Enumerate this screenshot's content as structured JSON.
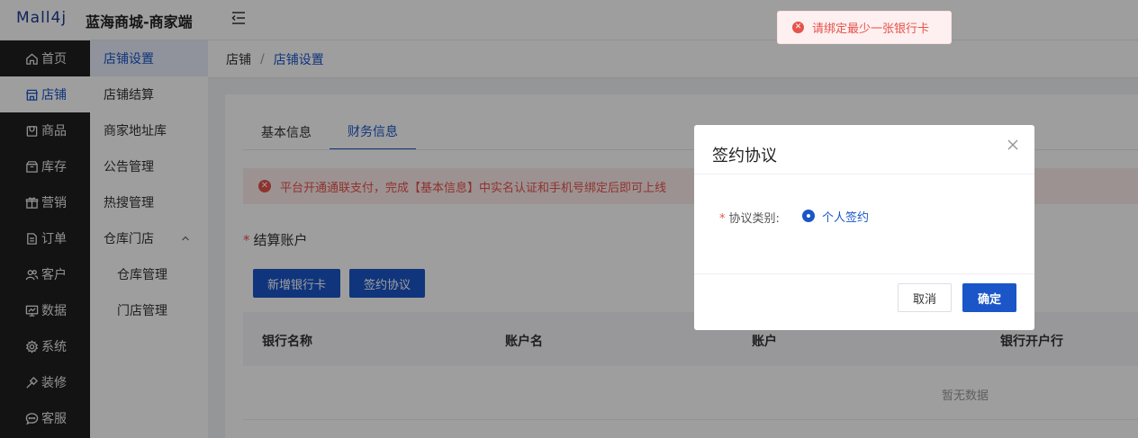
{
  "header": {
    "logo_text": "Mall4j",
    "shop_title": "蓝海商城-商家端"
  },
  "sidebar_primary": [
    {
      "label": "首页",
      "icon": "home-icon"
    },
    {
      "label": "店铺",
      "icon": "store-icon",
      "active": true
    },
    {
      "label": "商品",
      "icon": "product-icon"
    },
    {
      "label": "库存",
      "icon": "inventory-icon"
    },
    {
      "label": "营销",
      "icon": "gift-icon"
    },
    {
      "label": "订单",
      "icon": "order-icon"
    },
    {
      "label": "客户",
      "icon": "users-icon"
    },
    {
      "label": "数据",
      "icon": "chart-icon"
    },
    {
      "label": "系统",
      "icon": "gear-icon"
    },
    {
      "label": "装修",
      "icon": "decorate-icon"
    },
    {
      "label": "客服",
      "icon": "chat-icon"
    }
  ],
  "sidebar_secondary": [
    {
      "label": "店铺设置",
      "active": true
    },
    {
      "label": "店铺结算"
    },
    {
      "label": "商家地址库"
    },
    {
      "label": "公告管理"
    },
    {
      "label": "热搜管理"
    },
    {
      "label": "仓库门店",
      "expandable": true
    },
    {
      "label": "仓库管理",
      "sub": true
    },
    {
      "label": "门店管理",
      "sub": true
    }
  ],
  "breadcrumb": {
    "root": "店铺",
    "separator": "/",
    "current": "店铺设置"
  },
  "tabs": [
    {
      "label": "基本信息"
    },
    {
      "label": "财务信息",
      "active": true
    }
  ],
  "alert": {
    "text": "平台开通通联支付，完成【基本信息】中实名认证和手机号绑定后即可上线"
  },
  "settlement": {
    "title": "结算账户",
    "add_card_button": "新增银行卡",
    "agreement_button": "签约协议"
  },
  "table": {
    "columns": [
      "银行名称",
      "账户名",
      "账户",
      "银行开户行"
    ],
    "empty_text": "暂无数据"
  },
  "dialog": {
    "title": "签约协议",
    "field_label": "协议类别:",
    "option_label": "个人签约",
    "cancel_label": "取消",
    "confirm_label": "确定"
  },
  "toast": {
    "text": "请绑定最少一张银行卡"
  },
  "colors": {
    "primary": "#1a56c8",
    "error": "#e5534b",
    "sidebar_dark": "#1f1f1f"
  }
}
